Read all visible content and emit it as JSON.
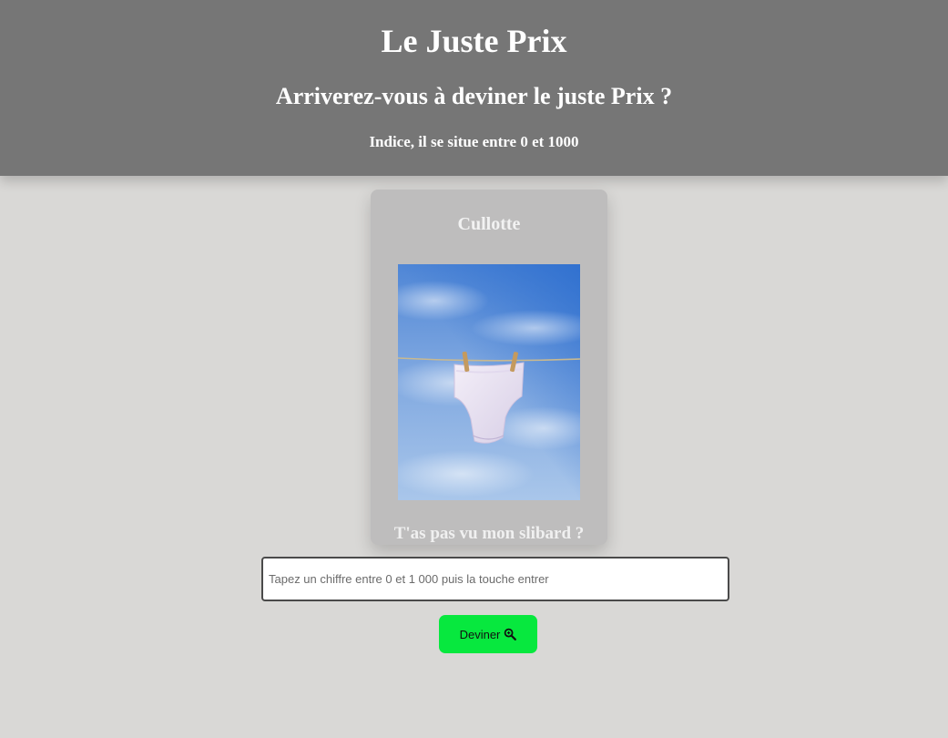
{
  "header": {
    "title": "Le Juste Prix",
    "subtitle": "Arriverez-vous à deviner le juste Prix ?",
    "hint": "Indice, il se situe entre 0 et 1000"
  },
  "product": {
    "name": "Cullotte",
    "caption": "T'as pas vu mon slibard ?",
    "image_icon": "underwear-on-clothesline"
  },
  "guess": {
    "placeholder": "Tapez un chiffre entre 0 et 1 000 puis la touche entrer",
    "value": "",
    "button_label": "Deviner",
    "button_icon": "magnifier-icon"
  },
  "colors": {
    "header_bg": "#767676",
    "page_bg": "#d9d8d6",
    "card_bg": "#bebdbd",
    "button_bg": "#07e83e"
  }
}
